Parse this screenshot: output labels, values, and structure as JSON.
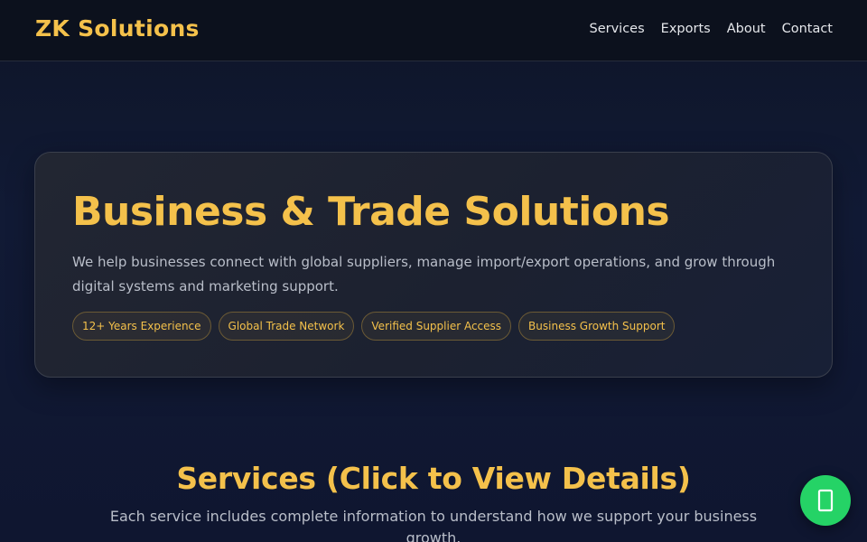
{
  "brand": {
    "name": "ZK Solutions"
  },
  "nav": {
    "items": [
      {
        "label": "Services"
      },
      {
        "label": "Exports"
      },
      {
        "label": "About"
      },
      {
        "label": "Contact"
      }
    ]
  },
  "hero": {
    "title": "Business & Trade Solutions",
    "description": "We help businesses connect with global suppliers, manage import/export operations, and grow through digital systems and marketing support.",
    "badges": [
      {
        "label": "12+ Years Experience"
      },
      {
        "label": "Global Trade Network"
      },
      {
        "label": "Verified Supplier Access"
      },
      {
        "label": "Business Growth Support"
      }
    ]
  },
  "services": {
    "title": "Services (Click to View Details)",
    "subtitle": "Each service includes complete information to understand how we support your business growth."
  },
  "chat_button": {
    "icon": "whatsapp-icon",
    "color": "#25d366"
  },
  "colors": {
    "accent": "#f4c14b",
    "background": "#0e1528",
    "chat": "#25d366"
  }
}
